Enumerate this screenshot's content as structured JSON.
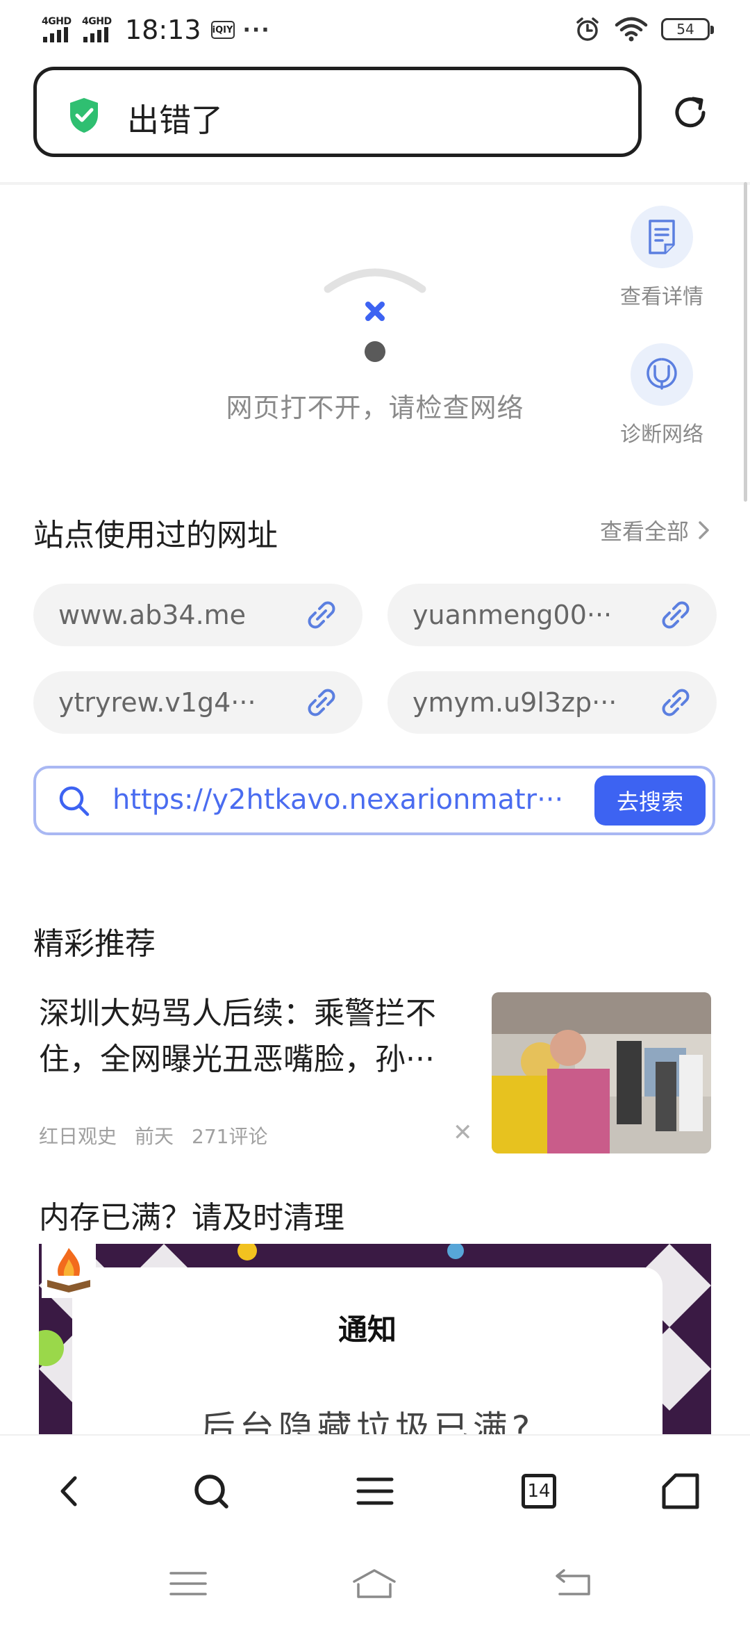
{
  "status_bar": {
    "signal1": "4GHD",
    "signal2": "4GHD",
    "time": "18:13",
    "app_badge": "iQIY",
    "more": "···",
    "battery": "54"
  },
  "address_bar": {
    "title": "出错了"
  },
  "error": {
    "message": "网页打不开，请检查网络",
    "view_details": "查看详情",
    "diagnose": "诊断网络"
  },
  "sites": {
    "title": "站点使用过的网址",
    "view_all": "查看全部",
    "items": [
      {
        "label": "www.ab34.me"
      },
      {
        "label": "yuanmeng00···"
      },
      {
        "label": "ytryrew.v1g4···"
      },
      {
        "label": "ymym.u9l3zp···"
      }
    ]
  },
  "search": {
    "url": "https://y2htkavo.nexarionmatr···",
    "button": "去搜索"
  },
  "recommend": {
    "title": "精彩推荐",
    "news": {
      "headline": "深圳大妈骂人后续：乘警拦不住，全网曝光丑恶嘴脸，孙···",
      "source": "红日观史",
      "time": "前天",
      "comments": "271评论"
    },
    "ad": {
      "title": "内存已满？请及时清理",
      "notice_title": "通知",
      "notice_body": "后台隐藏垃圾已满?"
    }
  },
  "toolbar": {
    "tab_count": "14"
  },
  "colors": {
    "accent": "#3d63f2",
    "shield": "#2fbf71",
    "ad_bg": "#3a1a44"
  }
}
